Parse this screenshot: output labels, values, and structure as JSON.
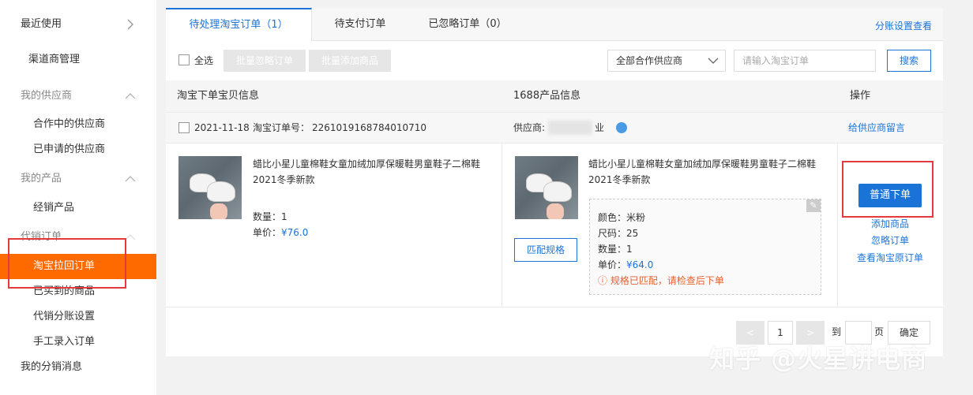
{
  "sidebar": {
    "recent": "最近使用",
    "channel_mgmt": "渠道商管理",
    "my_suppliers": "我的供应商",
    "cooperating_suppliers": "合作中的供应商",
    "applied_suppliers": "已申请的供应商",
    "my_products": "我的产品",
    "distribution_products": "经销产品",
    "consign_orders": "代销订单",
    "taobao_pulled_orders": "淘宝拉回订单",
    "purchased_products": "已买到的商品",
    "consign_split_settings": "代销分账设置",
    "manual_entry": "手工录入订单",
    "my_distribution_msgs": "我的分销消息"
  },
  "tabs": {
    "pending": "待处理淘宝订单（1）",
    "unpaid": "待支付订单",
    "ignored": "已忽略订单（0）",
    "split_settings_link": "分账设置查看"
  },
  "toolbar": {
    "select_all": "全选",
    "batch_ignore": "批量忽略订单",
    "batch_add": "批量添加商品",
    "supplier_select": "全部合作供应商",
    "search_placeholder": "请输入淘宝订单",
    "search_button": "搜索"
  },
  "table": {
    "col_taobao": "淘宝下单宝贝信息",
    "col_1688": "1688产品信息",
    "col_ops": "操作"
  },
  "order": {
    "date": "2021-11-18",
    "order_no_label": "淘宝订单号：",
    "order_no": "2261019168784010710",
    "supplier_label": "供应商:",
    "supplier_suffix": "业",
    "message_supplier": "给供应商留言"
  },
  "taobao_item": {
    "title": "蜡比小星儿童棉鞋女童加绒加厚保暖鞋男童鞋子二棉鞋2021冬季新款",
    "qty_label": "数量：",
    "qty": "1",
    "price_label": "单价：",
    "price": "¥76.0"
  },
  "product_1688": {
    "title": "蜡比小星儿童棉鞋女童加绒加厚保暖鞋男童鞋子二棉鞋2021冬季新款",
    "match_spec_button": "匹配规格",
    "color_label": "颜色：",
    "color": "米粉",
    "size_label": "尺码：",
    "size": "25",
    "qty_label": "数量：",
    "qty": "1",
    "price_label": "单价：",
    "price": "¥64.0",
    "notice_icon": "ⓘ",
    "notice": "规格已匹配，请检查后下单"
  },
  "actions": {
    "normal_order": "普通下单",
    "add_product": "添加商品",
    "ignore_order": "忽略订单",
    "view_taobao_order": "查看淘宝原订单"
  },
  "pagination": {
    "prev": "<",
    "current": "1",
    "next": ">",
    "goto_label": "到",
    "page_unit": "页",
    "confirm": "确定"
  },
  "watermark": "知乎 @火星讲电商",
  "colors": {
    "accent": "#1a74d8",
    "active_nav": "#ff6a00",
    "highlight_box": "#e5393b",
    "notice": "#e8602c"
  }
}
